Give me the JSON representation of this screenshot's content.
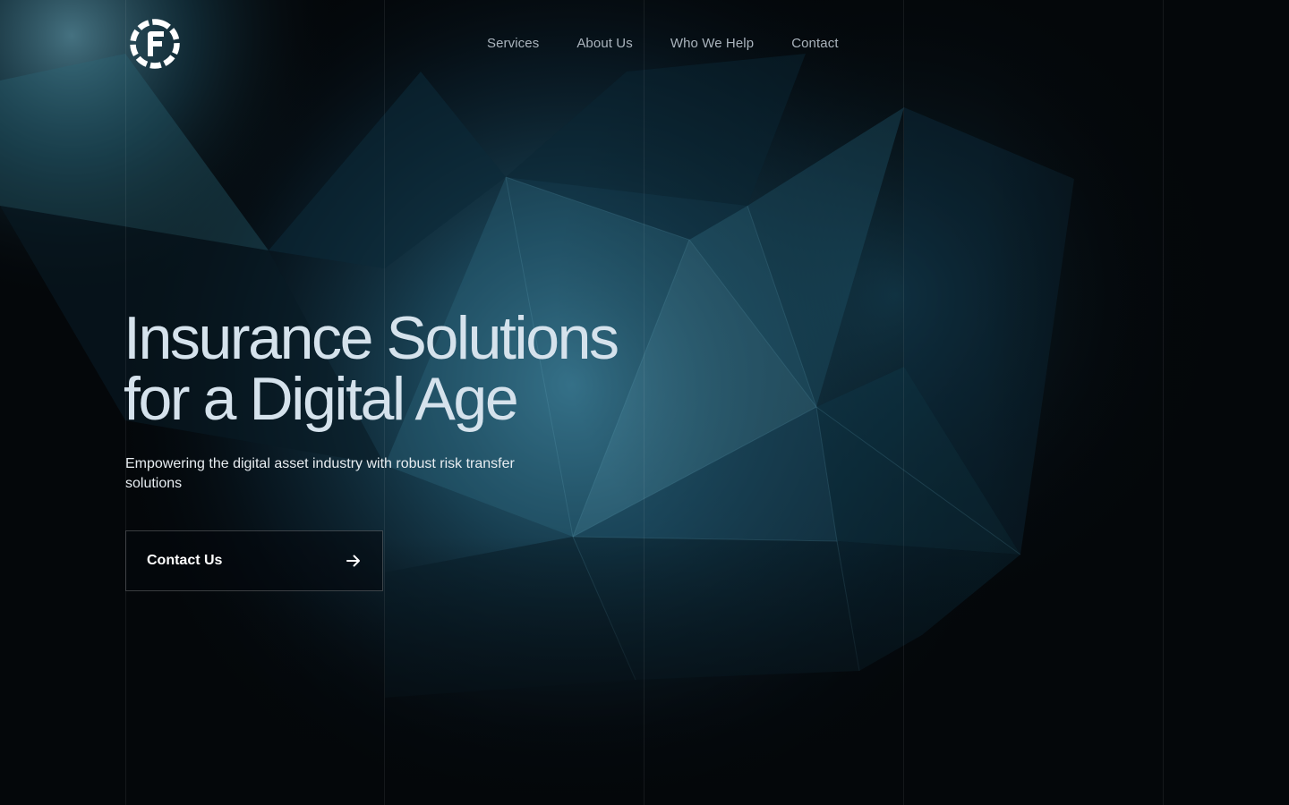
{
  "brand": {
    "logo_icon": "f-circle-logo-icon"
  },
  "nav": {
    "items": [
      {
        "label": "Services"
      },
      {
        "label": "About Us"
      },
      {
        "label": "Who We Help"
      },
      {
        "label": "Contact"
      }
    ]
  },
  "hero": {
    "title_line1": "Insurance Solutions",
    "title_line2": "for a Digital Age",
    "subtitle": "Empowering the digital asset industry with robust risk transfer solutions",
    "cta_label": "Contact Us",
    "cta_icon": "arrow-right-icon"
  },
  "colors": {
    "background": "#04070a",
    "accent": "#3f7d96",
    "text_primary": "#ffffff",
    "nav_text": "#aab4bd"
  }
}
